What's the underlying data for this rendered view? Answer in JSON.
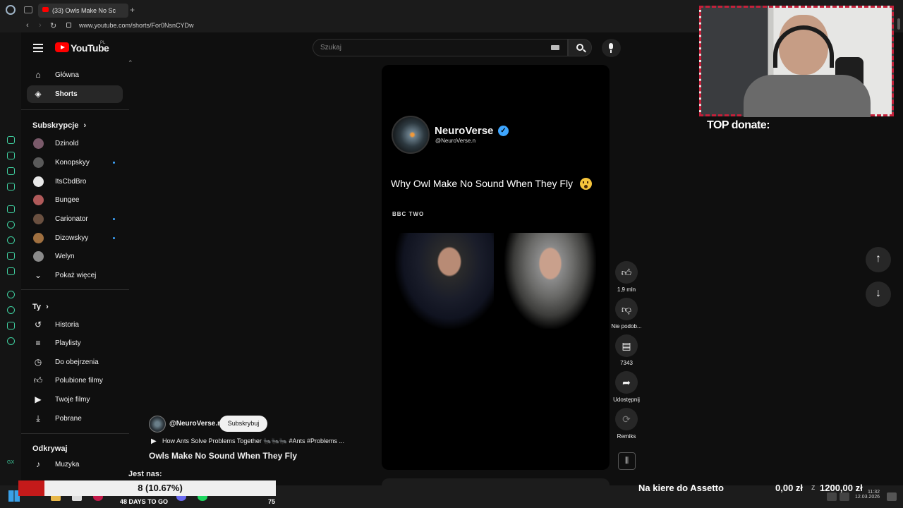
{
  "browser": {
    "tab_title": "(33) Owls Make No Sc",
    "new_tab": "+",
    "back": "‹",
    "forward": "›",
    "reload": "↻",
    "url": "www.youtube.com/shorts/For0NsnCYDw"
  },
  "youtube": {
    "logo_text": "YouTube",
    "region": "PL",
    "search": {
      "placeholder": "Szukaj"
    }
  },
  "sidebar": {
    "main": [
      {
        "label": "Główna",
        "icon": "home-icon"
      },
      {
        "label": "Shorts",
        "icon": "shorts-icon",
        "active": true
      }
    ],
    "subscriptions_title": "Subskrypcje",
    "subscriptions": [
      {
        "label": "Dzinold",
        "new": false
      },
      {
        "label": "Konopskyy",
        "new": true
      },
      {
        "label": "ItsCbdBro",
        "new": false
      },
      {
        "label": "Bungee",
        "new": false
      },
      {
        "label": "Carionator",
        "new": true
      },
      {
        "label": "Dizowskyy",
        "new": true
      },
      {
        "label": "Welyn",
        "new": false
      }
    ],
    "show_more": "Pokaż więcej",
    "you_title": "Ty",
    "you": [
      {
        "label": "Historia",
        "icon": "history-icon"
      },
      {
        "label": "Playlisty",
        "icon": "playlist-icon"
      },
      {
        "label": "Do obejrzenia",
        "icon": "watch-later-icon"
      },
      {
        "label": "Polubione filmy",
        "icon": "like-icon"
      },
      {
        "label": "Twoje filmy",
        "icon": "your-videos-icon"
      },
      {
        "label": "Pobrane",
        "icon": "download-icon"
      }
    ],
    "explore_title": "Odkrywaj",
    "explore": [
      {
        "label": "Muzyka",
        "icon": "music-icon"
      }
    ]
  },
  "short": {
    "channel_name": "NeuroVerse",
    "channel_handle": "@NeuroVerse.n",
    "caption": "Why Owl Make No Sound When They Fly",
    "broadcaster_logo": "BBC TWO",
    "actions": [
      {
        "label": "1,9 mln",
        "icon": "thumbs-up-icon"
      },
      {
        "label": "Nie podob...",
        "icon": "thumbs-down-icon"
      },
      {
        "label": "7343",
        "icon": "comments-icon"
      },
      {
        "label": "Udostępnij",
        "icon": "share-icon"
      },
      {
        "label": "Remiks",
        "icon": "remix-icon"
      }
    ]
  },
  "short_info": {
    "handle": "@NeuroVerse.n",
    "subscribe": "Subskrybuj",
    "related": "How Ants Solve Problems Together 🐜🐜🐜 #Ants #Problems ...",
    "title": "Owls Make No Sound When They Fly"
  },
  "overlay": {
    "top_donate": "TOP donate:",
    "jest_nas": "Jest nas:",
    "goal_progress": "8 (10.67%)",
    "goal_fraction": 0.1067,
    "days_to_go": "48 DAYS TO GO",
    "count": "75",
    "assetto_label": "Na kiere do Assetto",
    "assetto_current": "0,00 zł",
    "assetto_sep": "z",
    "assetto_target": "1200,00 zł"
  },
  "taskbar": {
    "time": "11:32",
    "date": "12.03.2026",
    "gx": "GX"
  },
  "colors": {
    "background": "#0f0f0f",
    "youtube_red": "#ff0000",
    "accent_blue": "#3ea6ff",
    "overlay_red": "#c5203a",
    "opera_rail_green": "#3fcf9f"
  }
}
